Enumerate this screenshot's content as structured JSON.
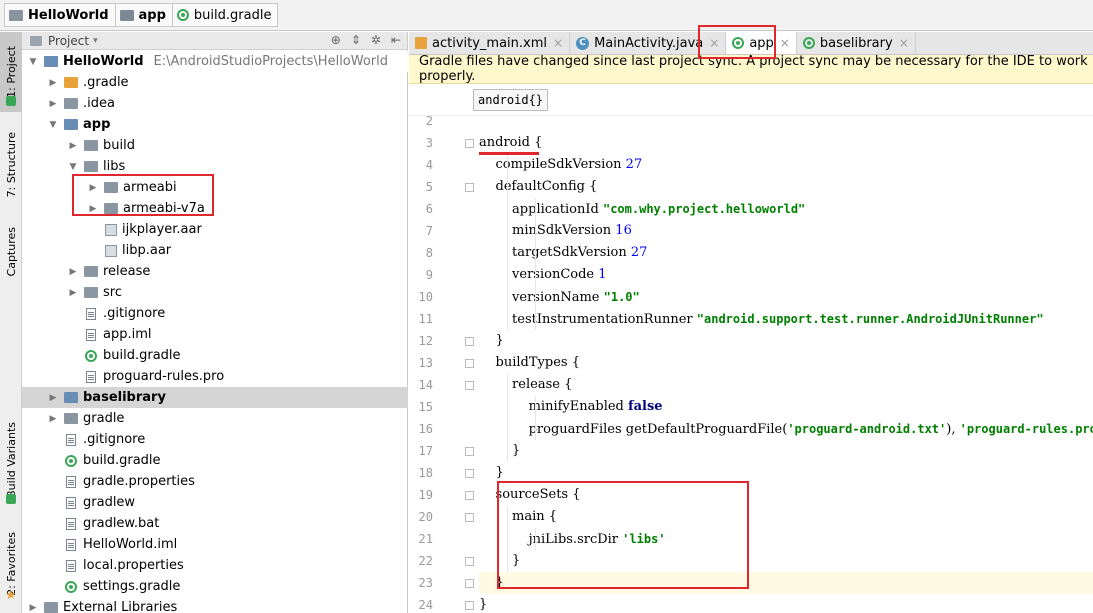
{
  "navbar": {
    "project": "HelloWorld",
    "module": "app",
    "file": "build.gradle"
  },
  "stripe": {
    "project": "1: Project",
    "structure": "7: Structure",
    "captures": "Captures",
    "build_variants": "Build Variants",
    "favorites": "2: Favorites"
  },
  "project_panel": {
    "view_selector": "Project",
    "tree": [
      {
        "label": "HelloWorld",
        "path": "E:\\AndroidStudioProjects\\HelloWorld",
        "bold": true
      },
      {
        "label": ".gradle"
      },
      {
        "label": ".idea"
      },
      {
        "label": "app",
        "bold": true
      },
      {
        "label": "build"
      },
      {
        "label": "libs"
      },
      {
        "label": "armeabi"
      },
      {
        "label": "armeabi-v7a"
      },
      {
        "label": "ijkplayer.aar"
      },
      {
        "label": "libp.aar"
      },
      {
        "label": "release"
      },
      {
        "label": "src"
      },
      {
        "label": ".gitignore"
      },
      {
        "label": "app.iml"
      },
      {
        "label": "build.gradle"
      },
      {
        "label": "proguard-rules.pro"
      },
      {
        "label": "baselibrary",
        "bold": true
      },
      {
        "label": "gradle"
      },
      {
        "label": ".gitignore"
      },
      {
        "label": "build.gradle"
      },
      {
        "label": "gradle.properties"
      },
      {
        "label": "gradlew"
      },
      {
        "label": "gradlew.bat"
      },
      {
        "label": "HelloWorld.iml"
      },
      {
        "label": "local.properties"
      },
      {
        "label": "settings.gradle"
      },
      {
        "label": "External Libraries"
      }
    ]
  },
  "editor": {
    "tabs": [
      "activity_main.xml",
      "MainActivity.java",
      "app",
      "baselibrary"
    ],
    "active_tab": "app",
    "banner": "Gradle files have changed since last project sync. A project sync may be necessary for the IDE to work properly.",
    "breadcrumb_chip": "android{}",
    "lines": [
      {
        "n": "2",
        "text": ""
      },
      {
        "n": "3",
        "text": "android {"
      },
      {
        "n": "4",
        "text": "    compileSdkVersion 27"
      },
      {
        "n": "5",
        "text": "    defaultConfig {"
      },
      {
        "n": "6",
        "text": "        applicationId \"com.why.project.helloworld\""
      },
      {
        "n": "7",
        "text": "        minSdkVersion 16"
      },
      {
        "n": "8",
        "text": "        targetSdkVersion 27"
      },
      {
        "n": "9",
        "text": "        versionCode 1"
      },
      {
        "n": "10",
        "text": "        versionName \"1.0\""
      },
      {
        "n": "11",
        "text": "        testInstrumentationRunner \"android.support.test.runner.AndroidJUnitRunner\""
      },
      {
        "n": "12",
        "text": "    }"
      },
      {
        "n": "13",
        "text": "    buildTypes {"
      },
      {
        "n": "14",
        "text": "        release {"
      },
      {
        "n": "15",
        "text": "            minifyEnabled false"
      },
      {
        "n": "16",
        "text": "            proguardFiles getDefaultProguardFile('proguard-android.txt'), 'proguard-rules.pro'"
      },
      {
        "n": "17",
        "text": "        }"
      },
      {
        "n": "18",
        "text": "    }"
      },
      {
        "n": "19",
        "text": "    sourceSets {"
      },
      {
        "n": "20",
        "text": "        main {"
      },
      {
        "n": "21",
        "text": "            jniLibs.srcDir 'libs'"
      },
      {
        "n": "22",
        "text": "        }"
      },
      {
        "n": "23",
        "text": "    }"
      },
      {
        "n": "24",
        "text": "}"
      }
    ]
  },
  "colors": {
    "annotation_red": "#e0272d",
    "banner_bg": "#fff8cc",
    "string_green": "#008000",
    "number_blue": "#0000ff",
    "keyword_navy": "#000080"
  }
}
